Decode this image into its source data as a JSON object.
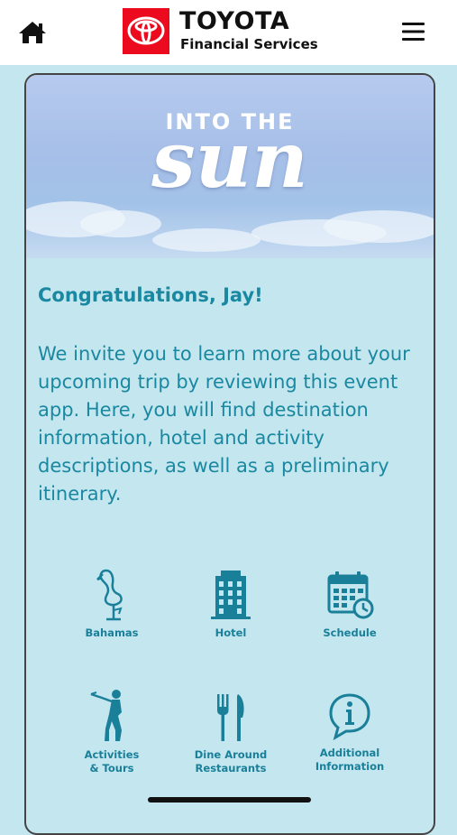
{
  "header": {
    "brand_name": "TOYOTA",
    "brand_sub": "Financial Services",
    "brand_color": "#eb0a1e"
  },
  "hero": {
    "line1": "INTO THE",
    "line2": "sun"
  },
  "greeting": "Congratulations, Jay!",
  "intro": "We invite you to learn more about your upcoming trip by reviewing this event app. Here, you will find destination information, hotel and activity descriptions, as well as a preliminary itinerary.",
  "tiles": [
    {
      "label": "Bahamas",
      "icon": "flamingo-icon"
    },
    {
      "label": "Hotel",
      "icon": "building-icon"
    },
    {
      "label": "Schedule",
      "icon": "calendar-clock-icon"
    },
    {
      "label": "Activities\n& Tours",
      "icon": "golfer-icon"
    },
    {
      "label": "Dine Around\nRestaurants",
      "icon": "fork-knife-icon"
    },
    {
      "label": "Additional\nInformation",
      "icon": "info-bubble-icon"
    }
  ],
  "colors": {
    "accent": "#1a88a0",
    "background": "#c3e6ef"
  }
}
